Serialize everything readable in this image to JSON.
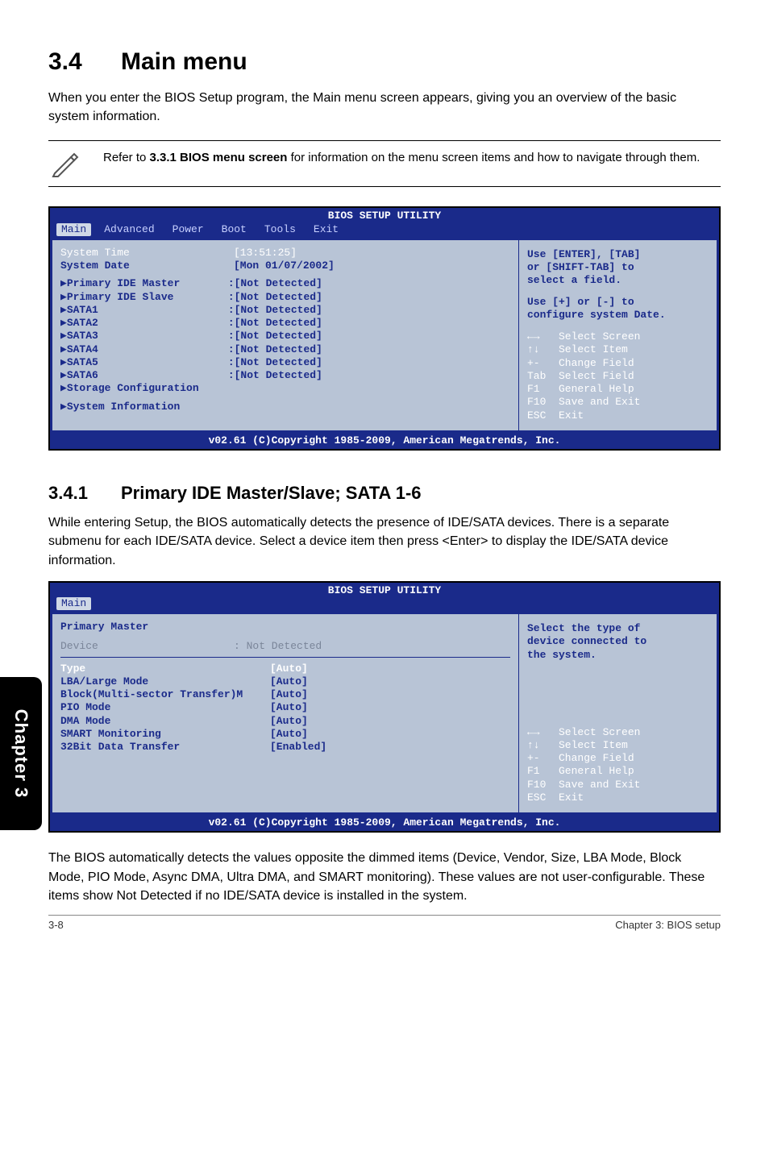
{
  "sideTab": "Chapter 3",
  "heading": {
    "num": "3.4",
    "title": "Main menu"
  },
  "intro": "When you enter the BIOS Setup program, the Main menu screen appears, giving you an overview of the basic system information.",
  "note": {
    "pre": "Refer to ",
    "bold": "3.3.1 BIOS menu screen",
    "post": " for information on the menu screen items and how to navigate through them."
  },
  "bios1": {
    "title": "BIOS SETUP UTILITY",
    "tabs": [
      "Main",
      "Advanced",
      "Power",
      "Boot",
      "Tools",
      "Exit"
    ],
    "sysTimeLabel": "System Time",
    "sysTimeVal": "[13:51:25]",
    "sysDateLabel": "System Date",
    "sysDateVal": "[Mon 01/07/2002]",
    "items": [
      {
        "l": "Primary IDE Master",
        "v": ":[Not Detected]"
      },
      {
        "l": "Primary IDE Slave",
        "v": ":[Not Detected]"
      },
      {
        "l": "SATA1",
        "v": ":[Not Detected]"
      },
      {
        "l": "SATA2",
        "v": ":[Not Detected]"
      },
      {
        "l": "SATA3",
        "v": ":[Not Detected]"
      },
      {
        "l": "SATA4",
        "v": ":[Not Detected]"
      },
      {
        "l": "SATA5",
        "v": ":[Not Detected]"
      },
      {
        "l": "SATA6",
        "v": ":[Not Detected]"
      }
    ],
    "storage": "Storage Configuration",
    "sysinfo": "System Information",
    "help1": "Use [ENTER], [TAB]\nor [SHIFT-TAB] to\nselect a field.",
    "help2": "Use [+] or [-] to\nconfigure system Date.",
    "nav": "←→   Select Screen\n↑↓   Select Item\n+-   Change Field\nTab  Select Field\nF1   General Help\nF10  Save and Exit\nESC  Exit",
    "footer": "v02.61 (C)Copyright 1985-2009, American Megatrends, Inc."
  },
  "sub": {
    "num": "3.4.1",
    "title": "Primary IDE Master/Slave; SATA 1-6"
  },
  "subtext": "While entering Setup, the BIOS automatically detects the presence of IDE/SATA devices. There is a separate submenu for each IDE/SATA device. Select a device item then press <Enter> to display the IDE/SATA device information.",
  "bios2": {
    "title": "BIOS SETUP UTILITY",
    "tab": "Main",
    "header": "Primary Master",
    "deviceL": "Device",
    "deviceV": ": Not Detected",
    "rows": [
      {
        "l": "Type",
        "v": "[Auto]",
        "white": true
      },
      {
        "l": "LBA/Large Mode",
        "v": "[Auto]"
      },
      {
        "l": "Block(Multi-sector Transfer)M",
        "v": "[Auto]"
      },
      {
        "l": "PIO Mode",
        "v": "[Auto]"
      },
      {
        "l": "DMA Mode",
        "v": "[Auto]"
      },
      {
        "l": "SMART Monitoring",
        "v": "[Auto]"
      },
      {
        "l": "32Bit Data Transfer",
        "v": "[Enabled]"
      }
    ],
    "help": "Select the type of\ndevice connected to\nthe system.",
    "nav": "←→   Select Screen\n↑↓   Select Item\n+-   Change Field\nF1   General Help\nF10  Save and Exit\nESC  Exit",
    "footer": "v02.61 (C)Copyright 1985-2009, American Megatrends, Inc."
  },
  "closing": "The BIOS automatically detects the values opposite the dimmed items (Device, Vendor, Size, LBA Mode, Block Mode, PIO Mode, Async DMA, Ultra DMA, and SMART monitoring). These values are not user-configurable. These items show Not Detected if no IDE/SATA device is installed in the system.",
  "footerLeft": "3-8",
  "footerRight": "Chapter 3: BIOS setup"
}
